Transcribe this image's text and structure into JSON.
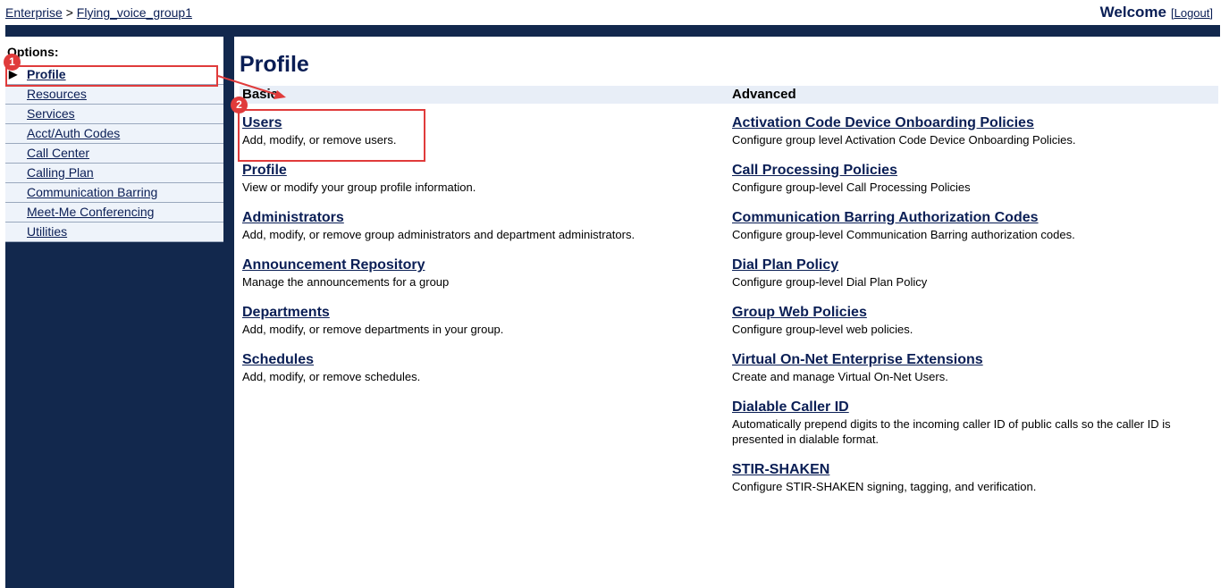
{
  "breadcrumb": {
    "enterprise": "Enterprise",
    "separator": ">",
    "group": "Flying_voice_group1"
  },
  "header": {
    "welcome": "Welcome",
    "logout": "[Logout]"
  },
  "sidebar": {
    "title": "Options:",
    "items": [
      {
        "label": "Profile",
        "active": true
      },
      {
        "label": "Resources"
      },
      {
        "label": "Services"
      },
      {
        "label": "Acct/Auth Codes"
      },
      {
        "label": "Call Center"
      },
      {
        "label": "Calling Plan"
      },
      {
        "label": "Communication Barring"
      },
      {
        "label": "Meet-Me Conferencing"
      },
      {
        "label": "Utilities"
      }
    ]
  },
  "main": {
    "title": "Profile",
    "basic": {
      "heading": "Basic",
      "items": [
        {
          "label": "Users",
          "desc": "Add, modify, or remove users."
        },
        {
          "label": "Profile",
          "desc": "View or modify your group profile information."
        },
        {
          "label": "Administrators",
          "desc": "Add, modify, or remove group administrators and department administrators."
        },
        {
          "label": "Announcement Repository",
          "desc": "Manage the announcements for a group"
        },
        {
          "label": "Departments",
          "desc": "Add, modify, or remove departments in your group."
        },
        {
          "label": "Schedules",
          "desc": "Add, modify, or remove schedules."
        }
      ]
    },
    "advanced": {
      "heading": "Advanced",
      "items": [
        {
          "label": "Activation Code Device Onboarding Policies",
          "desc": "Configure group level Activation Code Device Onboarding Policies."
        },
        {
          "label": "Call Processing Policies",
          "desc": "Configure group-level Call Processing Policies"
        },
        {
          "label": "Communication Barring Authorization Codes",
          "desc": "Configure group-level Communication Barring authorization codes."
        },
        {
          "label": "Dial Plan Policy",
          "desc": "Configure group-level Dial Plan Policy"
        },
        {
          "label": "Group Web Policies",
          "desc": "Configure group-level web policies."
        },
        {
          "label": "Virtual On-Net Enterprise Extensions",
          "desc": "Create and manage Virtual On-Net Users."
        },
        {
          "label": "Dialable Caller ID",
          "desc": "Automatically prepend digits to the incoming caller ID of public calls so the caller ID is presented in dialable format."
        },
        {
          "label": "STIR-SHAKEN",
          "desc": "Configure STIR-SHAKEN signing, tagging, and verification."
        }
      ]
    }
  },
  "annotations": {
    "step1": "1",
    "step2": "2",
    "color": "#e03b3b"
  },
  "colors": {
    "navy": "#12284d",
    "link": "#0a1e55",
    "section_bar": "#e8eef7"
  }
}
